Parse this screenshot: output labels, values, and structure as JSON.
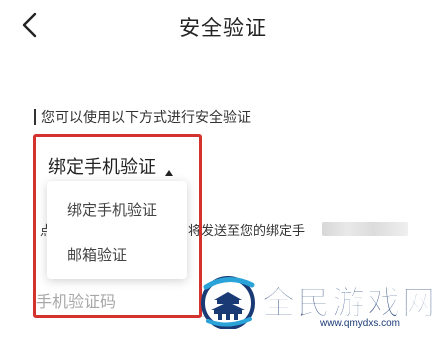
{
  "header": {
    "title": "安全验证",
    "back_icon": "chevron-left-icon"
  },
  "instruction": "您可以使用以下方式进行安全验证",
  "method_select": {
    "selected": "绑定手机验证",
    "caret_icon": "caret-up-icon"
  },
  "dropdown": {
    "options": [
      "绑定手机验证",
      "邮箱验证"
    ]
  },
  "hint": {
    "prefix": "点",
    "text": "将发送至您的绑定手"
  },
  "code_input": {
    "placeholder": "手机验证码",
    "value": ""
  },
  "highlight_color": "#d4322d",
  "watermark": {
    "title": "全民游戏网",
    "url": "www.qmydxs.com",
    "logo_icon": "pagoda-logo-icon",
    "color": "#1a3a75"
  }
}
